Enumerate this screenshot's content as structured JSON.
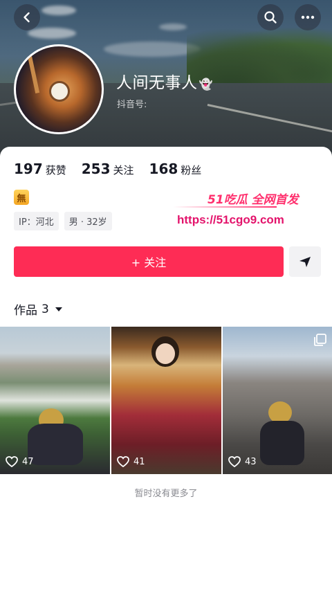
{
  "header": {
    "nickname": "人间无事人",
    "douyin_id_label": "抖音号:",
    "icons": {
      "back": "back-arrow-icon",
      "search": "search-icon",
      "more": "more-icon"
    }
  },
  "stats": [
    {
      "num": "197",
      "label": "获赞"
    },
    {
      "num": "253",
      "label": "关注"
    },
    {
      "num": "168",
      "label": "粉丝"
    }
  ],
  "badge": "無",
  "tags": [
    "IP：河北",
    "男 · 32岁"
  ],
  "watermark": {
    "title": "51吃瓜 全网首发",
    "url": "https://51cgo9.com"
  },
  "follow_button": "+ 关注",
  "works": {
    "label": "作品",
    "count": "3"
  },
  "grid": [
    {
      "likes": "47"
    },
    {
      "likes": "41"
    },
    {
      "likes": "43"
    }
  ],
  "end_text": "暂时没有更多了",
  "colors": {
    "accent": "#fe2c55",
    "watermark": "#ff2f6d"
  }
}
